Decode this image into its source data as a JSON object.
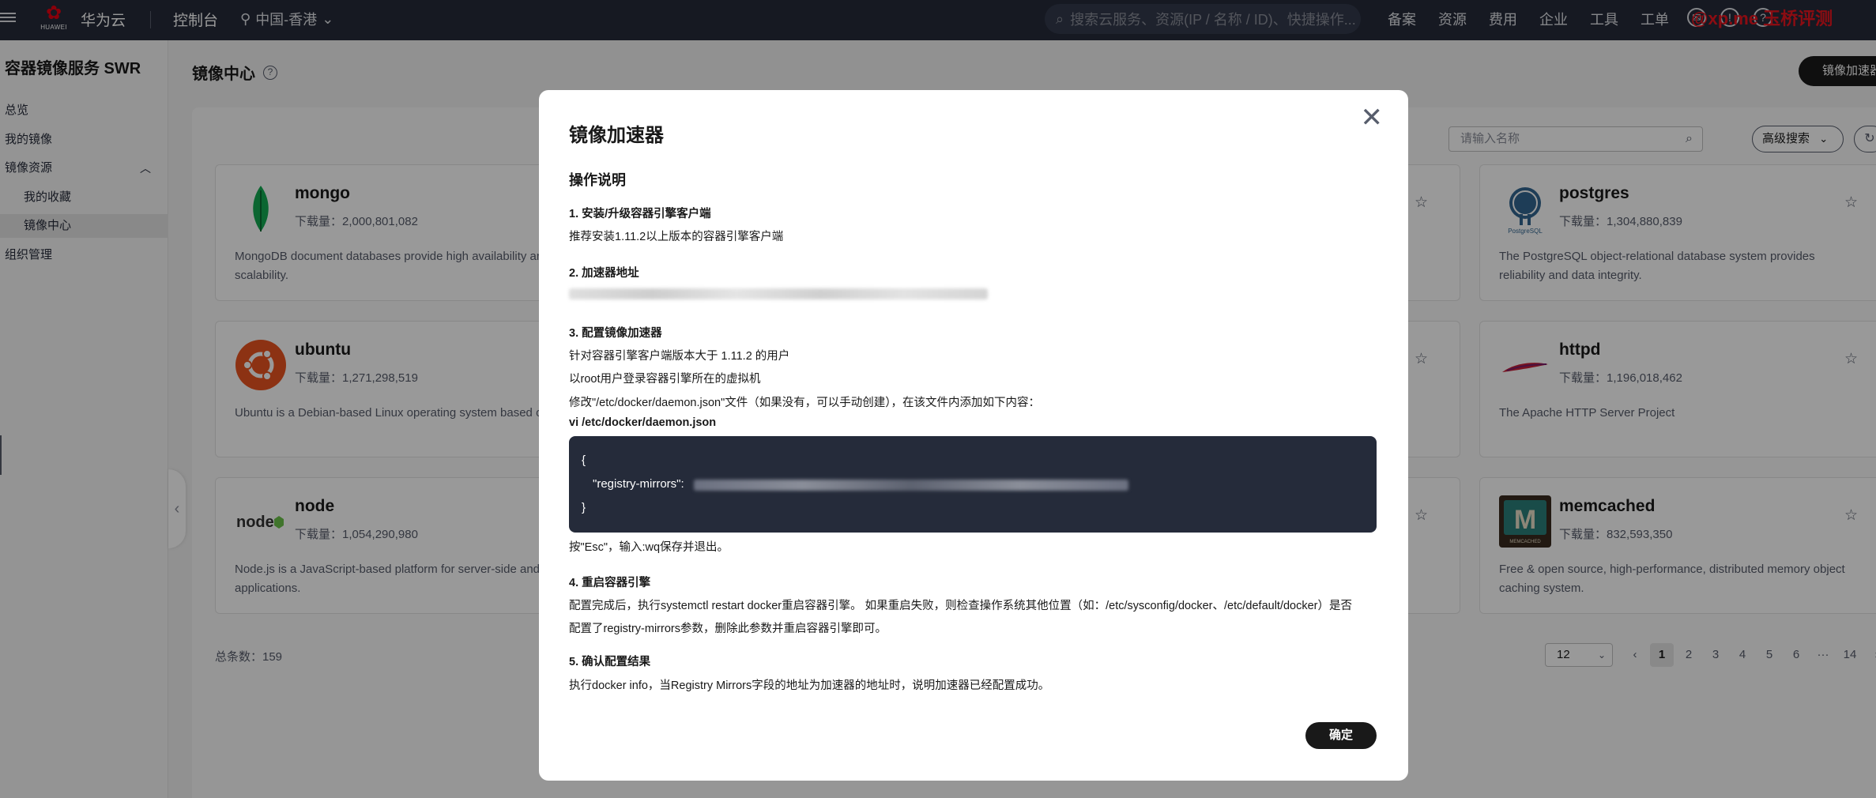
{
  "topbar": {
    "logo_text": "HUAWEI",
    "brand": "华为云",
    "console": "控制台",
    "region": "中国-香港",
    "search_placeholder": "搜索云服务、资源(IP / 名称 / ID)、快捷操作...",
    "nav": [
      "备案",
      "资源",
      "费用",
      "企业",
      "工具",
      "工单"
    ],
    "watermark": "@xp.me 玉桥评测"
  },
  "sidebar": {
    "title": "容器镜像服务 SWR",
    "items": [
      {
        "label": "总览"
      },
      {
        "label": "我的镜像"
      },
      {
        "label": "镜像资源"
      },
      {
        "label": "我的收藏"
      },
      {
        "label": "镜像中心"
      },
      {
        "label": "组织管理"
      }
    ]
  },
  "main": {
    "title": "镜像中心",
    "accelerator_button": "镜像加速器",
    "filter_placeholder": "请输入名称",
    "advanced_search": "高级搜索",
    "cards": [
      {
        "name": "mongo",
        "downloads": "下载量：2,000,801,082",
        "desc": "MongoDB document databases provide high availability an scalability.",
        "icon": "mongo-leaf-icon"
      },
      {
        "name": "ubuntu",
        "downloads": "下载量：1,271,298,519",
        "desc": "Ubuntu is a Debian-based Linux operating system based o software.",
        "icon": "ubuntu-logo-icon"
      },
      {
        "name": "node",
        "downloads": "下载量：1,054,290,980",
        "desc": "Node.js is a JavaScript-based platform for server-side and applications.",
        "icon": "nodejs-logo-icon"
      },
      {
        "name": "postgres",
        "downloads": "下载量：1,304,880,839",
        "desc": "The PostgreSQL object-relational database system provides reliability and data integrity.",
        "icon": "postgres-elephant-icon"
      },
      {
        "name": "httpd",
        "downloads": "下载量：1,196,018,462",
        "desc": "The Apache HTTP Server Project",
        "icon": "apache-feather-icon"
      },
      {
        "name": "memcached",
        "downloads": "下载量：832,593,350",
        "desc": "Free & open source, high-performance, distributed memory object caching system.",
        "icon": "memcached-logo-icon"
      }
    ],
    "total": "总条数：159",
    "page_size": "12",
    "pages": [
      "1",
      "2",
      "3",
      "4",
      "5",
      "6",
      "···",
      "14"
    ]
  },
  "modal": {
    "title": "镜像加速器",
    "section": "操作说明",
    "step1_title": "1. 安装/升级容器引擎客户端",
    "step1_text": "推荐安装1.11.2以上版本的容器引擎客户端",
    "step2_title": "2. 加速器地址",
    "step3_title": "3. 配置镜像加速器",
    "step3_line1": "针对容器引擎客户端版本大于 1.11.2 的用户",
    "step3_line2": "以root用户登录容器引擎所在的虚拟机",
    "step3_line3": "修改\"/etc/docker/daemon.json\"文件（如果没有，可以手动创建），在该文件内添加如下内容：",
    "step3_cmd": "vi /etc/docker/daemon.json",
    "code_open": "{",
    "code_key": "\"registry-mirrors\":",
    "code_close": "}",
    "step3_after": "按\"Esc\"，输入:wq保存并退出。",
    "step4_title": "4. 重启容器引擎",
    "step4_line1": "配置完成后，执行systemctl restart docker重启容器引擎。 如果重启失败，则检查操作系统其他位置（如：/etc/sysconfig/docker、/etc/default/docker）是否",
    "step4_line2": "配置了registry-mirrors参数，删除此参数并重启容器引擎即可。",
    "step5_title": "5. 确认配置结果",
    "step5_text": "执行docker info，当Registry Mirrors字段的地址为加速器的地址时，说明加速器已经配置成功。",
    "ok": "确定"
  }
}
